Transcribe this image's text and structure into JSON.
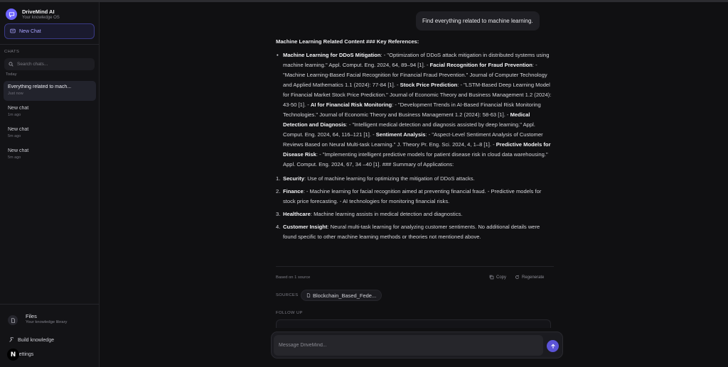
{
  "app": {
    "name": "DriveMind AI",
    "tagline": "Your knowledge OS"
  },
  "sidebar": {
    "new_chat_label": "New Chat",
    "chats_heading": "CHATS",
    "search_placeholder": "Search chats...",
    "group_today": "Today",
    "chats": [
      {
        "title": "Everything related to mach...",
        "time": "Just now",
        "active": true
      },
      {
        "title": "New chat",
        "time": "1m ago"
      },
      {
        "title": "New chat",
        "time": "5m ago"
      },
      {
        "title": "New chat",
        "time": "5m ago"
      }
    ],
    "files": {
      "title": "Files",
      "subtitle": "Your knowledge library"
    },
    "build_label": "Build knowledge",
    "avatar_letter": "N",
    "settings_label": "Settings"
  },
  "conversation": {
    "user_message": "Find everything related to machine learning.",
    "answer_heading": "Machine Learning Related Content ### Key References:",
    "bullet_text": [
      {
        "b": "Machine Learning for DDoS Mitigation"
      },
      {
        "t": ": - \"Optimization of DDoS attack mitigation in distributed systems using machine learning.\" Appl. Comput. Eng. 2024, 64, 89–94 [1]. - "
      },
      {
        "b": "Facial Recognition for Fraud Prevention"
      },
      {
        "t": ": - \"Machine Learning-Based Facial Recognition for Financial Fraud Prevention.\" Journal of Computer Technology and Applied Mathematics 1.1 (2024): 77-84 [1]. - "
      },
      {
        "b": "Stock Price Prediction"
      },
      {
        "t": ": - \"LSTM-Based Deep Learning Model for Financial Market Stock Price Prediction.\" Journal of Economic Theory and Business Management 1.2 (2024): 43-50 [1]. - "
      },
      {
        "b": "AI for Financial Risk Monitoring"
      },
      {
        "t": ": - \"Development Trends in AI-Based Financial Risk Monitoring Technologies.\" Journal of Economic Theory and Business Management 1.2 (2024): 58-63 [1]. - "
      },
      {
        "b": "Medical Detection and Diagnosis"
      },
      {
        "t": ": - \"Intelligent medical detection and diagnosis assisted by deep learning.\" Appl. Comput. Eng. 2024, 64, 116–121 [1]. - "
      },
      {
        "b": "Sentiment Analysis"
      },
      {
        "t": ": - \"Aspect-Level Sentiment Analysis of Customer Reviews Based on Neural Multi-task Learning.\" J. Theory Pr. Eng. Sci. 2024, 4, 1–8 [1]. - "
      },
      {
        "b": "Predictive Models for Disease Risk"
      },
      {
        "t": ": - \"Implementing intelligent predictive models for patient disease risk in cloud data warehousing.\" Appl. Comput. Eng. 2024, 67, 34 –40 [1]. ### Summary of Applications:"
      }
    ],
    "numbered": [
      {
        "num": "1.",
        "label": "Security",
        "text": ": Use of machine learning for optimizing the mitigation of DDoS attacks."
      },
      {
        "num": "2.",
        "label": "Finance",
        "text": ": - Machine learning for facial recognition aimed at preventing financial fraud. - Predictive models for stock price forecasting. - AI technologies for monitoring financial risks."
      },
      {
        "num": "3.",
        "label": "Healthcare",
        "text": ": Machine learning assists in medical detection and diagnostics."
      },
      {
        "num": "4.",
        "label": "Customer Insight",
        "text": ": Neural multi-task learning for analyzing customer sentiments. No additional details were found specific to other machine learning methods or theories not mentioned above."
      }
    ],
    "based_on": "Based on 1 source",
    "copy_label": "Copy",
    "regenerate_label": "Regenerate",
    "sources_label": "SOURCES",
    "source_chip": "Blockchain_Based_Fede...",
    "followup_label": "FOLLOW UP"
  },
  "composer": {
    "placeholder": "Message DriveMind..."
  },
  "colors": {
    "accent": "#6c63ff",
    "background": "#101012",
    "sidebar": "#131316"
  }
}
